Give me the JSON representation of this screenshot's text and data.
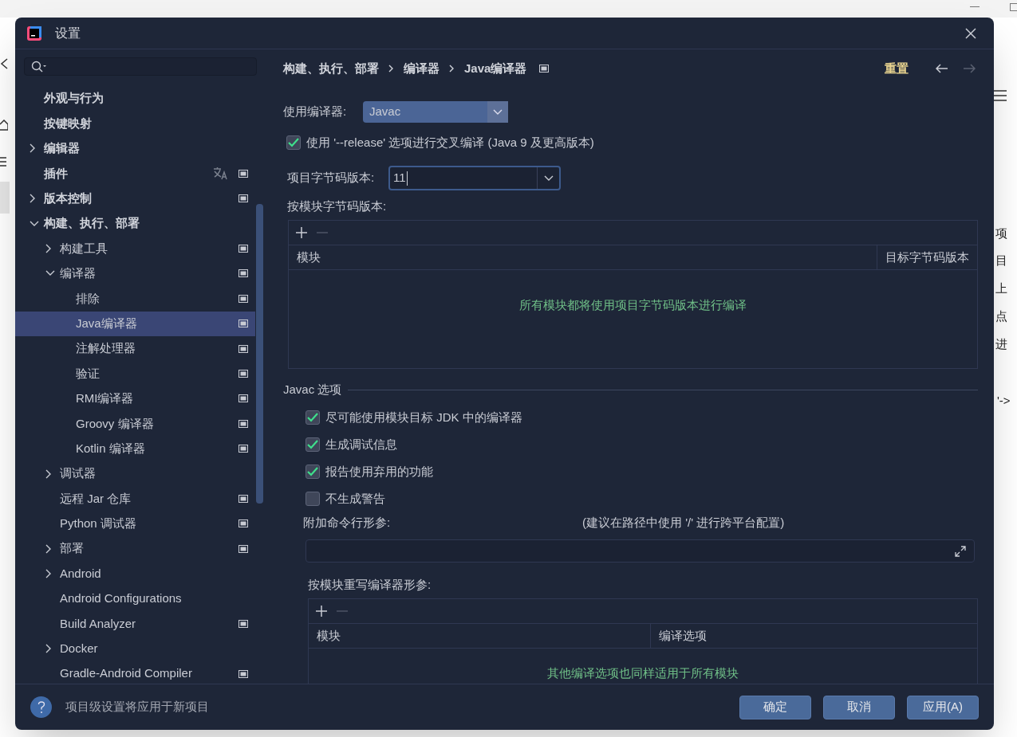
{
  "background_window": {
    "snippets": [
      "项",
      "目",
      "上",
      "点",
      "进",
      "'->"
    ]
  },
  "window": {
    "title": "设置"
  },
  "sidebar": {
    "items": [
      {
        "label": "外观与行为",
        "selected": false,
        "project_level": false
      },
      {
        "label": "按键映射",
        "selected": false,
        "project_level": false
      },
      {
        "label": "编辑器",
        "selected": false,
        "expanded": false,
        "project_level": false
      },
      {
        "label": "插件",
        "selected": false,
        "project_level": true,
        "language_icon": true
      },
      {
        "label": "版本控制",
        "selected": false,
        "expanded": false,
        "project_level": true
      },
      {
        "label": "构建、执行、部署",
        "selected": false,
        "expanded": true,
        "project_level": false,
        "children": [
          {
            "label": "构建工具",
            "selected": false,
            "expanded": false,
            "project_level": true
          },
          {
            "label": "编译器",
            "selected": false,
            "expanded": true,
            "project_level": true,
            "children": [
              {
                "label": "排除",
                "selected": false,
                "project_level": true
              },
              {
                "label": "Java编译器",
                "selected": true,
                "project_level": true
              },
              {
                "label": "注解处理器",
                "selected": false,
                "project_level": true
              },
              {
                "label": "验证",
                "selected": false,
                "project_level": true
              },
              {
                "label": "RMI编译器",
                "selected": false,
                "project_level": true
              },
              {
                "label": "Groovy 编译器",
                "selected": false,
                "project_level": true
              },
              {
                "label": "Kotlin 编译器",
                "selected": false,
                "project_level": true
              }
            ]
          },
          {
            "label": "调试器",
            "selected": false,
            "expanded": false,
            "project_level": false
          },
          {
            "label": "远程 Jar 仓库",
            "selected": false,
            "project_level": true
          },
          {
            "label": "Python 调试器",
            "selected": false,
            "project_level": true
          },
          {
            "label": "部署",
            "selected": false,
            "expanded": false,
            "project_level": true
          },
          {
            "label": "Android",
            "selected": false,
            "expanded": false,
            "project_level": false
          },
          {
            "label": "Android Configurations",
            "selected": false,
            "project_level": false
          },
          {
            "label": "Build Analyzer",
            "selected": false,
            "project_level": true
          },
          {
            "label": "Docker",
            "selected": false,
            "expanded": false,
            "project_level": false
          },
          {
            "label": "Gradle-Android Compiler",
            "selected": false,
            "project_level": true
          }
        ]
      }
    ]
  },
  "header": {
    "breadcrumb": [
      "构建、执行、部署",
      "编译器",
      "Java编译器"
    ],
    "reset": "重置",
    "forward_disabled": true
  },
  "compiler": {
    "label": "使用编译器:",
    "value": "Javac"
  },
  "release_option": {
    "label": "使用 '--release' 选项进行交叉编译 (Java 9 及更高版本)",
    "checked": true
  },
  "bytecode": {
    "label": "项目字节码版本:",
    "value": "11"
  },
  "per_module_bytecode": {
    "label": "按模块字节码版本:",
    "columns": [
      "模块",
      "目标字节码版本"
    ],
    "empty_text": "所有模块都将使用项目字节码版本进行编译"
  },
  "javac": {
    "title": "Javac 选项",
    "options": [
      {
        "label": "尽可能使用模块目标 JDK 中的编译器",
        "checked": true
      },
      {
        "label": "生成调试信息",
        "checked": true
      },
      {
        "label": "报告使用弃用的功能",
        "checked": true
      },
      {
        "label": "不生成警告",
        "checked": false
      }
    ],
    "params_label": "附加命令行形参:",
    "params_hint": "(建议在路径中使用 '/' 进行跨平台配置)",
    "override": {
      "label": "按模块重写编译器形参:",
      "columns": [
        "模块",
        "编译选项"
      ],
      "empty_text": "其他编译选项也同样适用于所有模块"
    }
  },
  "footer": {
    "hint": "项目级设置将应用于新项目",
    "buttons": [
      "确定",
      "取消",
      "应用(A)"
    ]
  }
}
